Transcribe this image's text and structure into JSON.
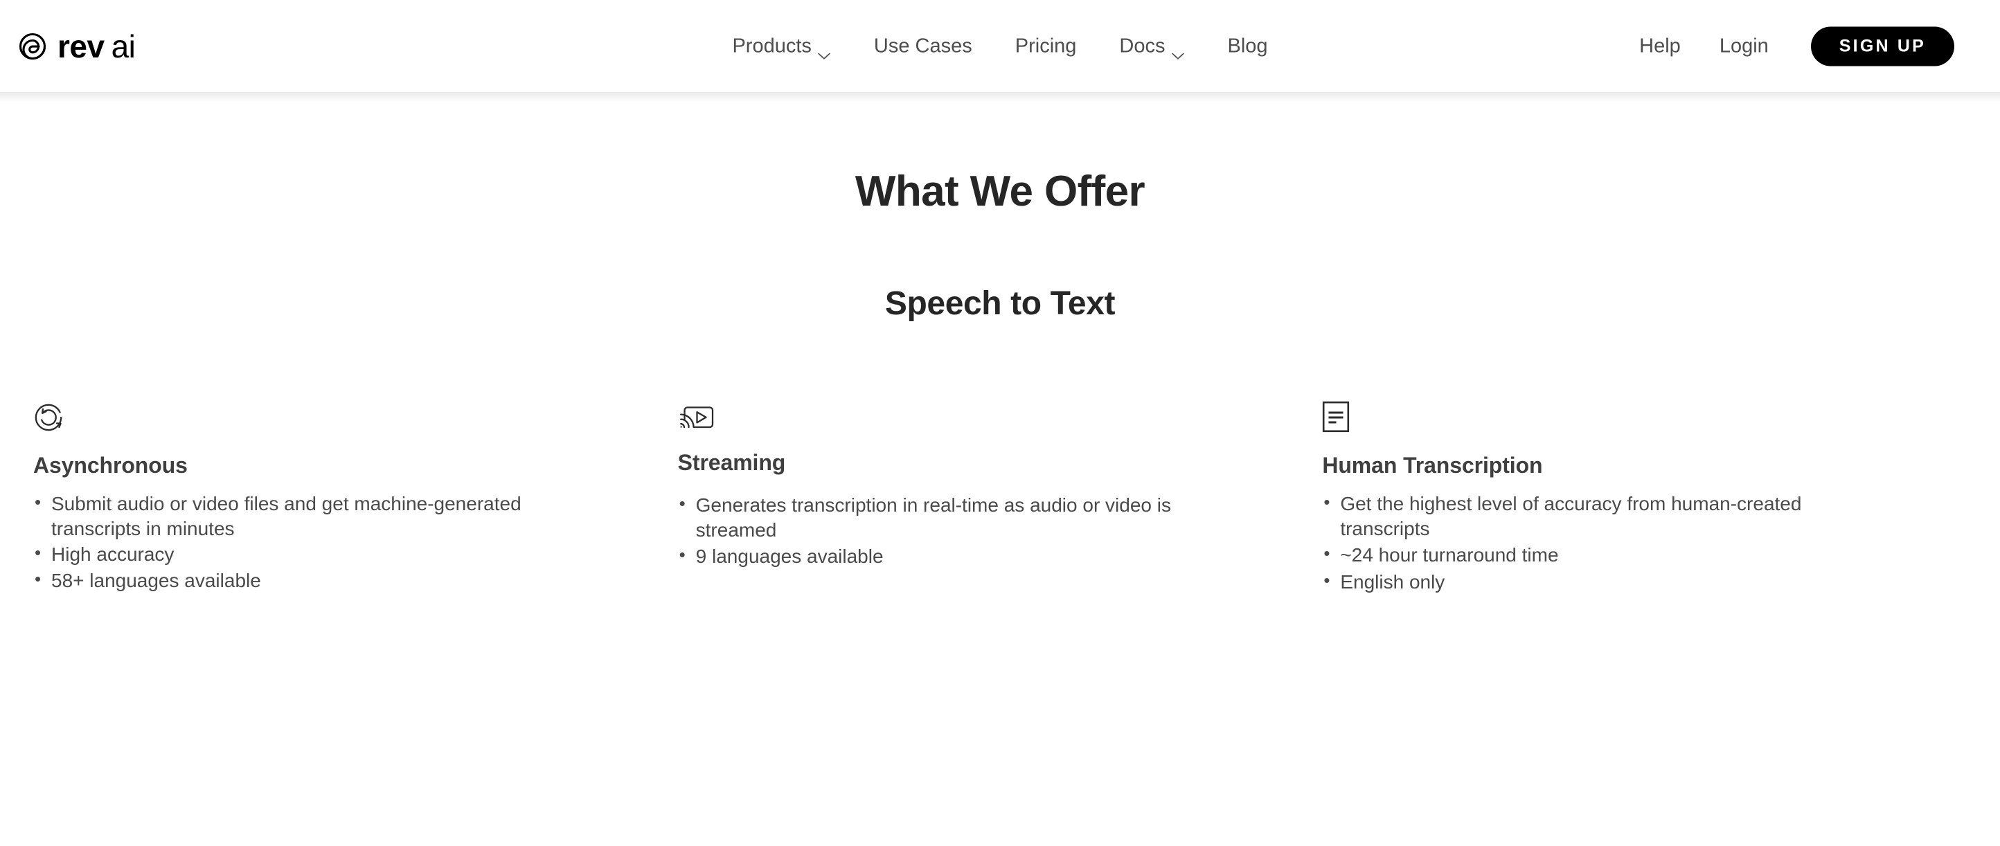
{
  "header": {
    "logo": {
      "mark_icon": "rev-spiral-logo-icon",
      "word_bold": "rev",
      "word_light": "ai"
    },
    "nav_items": [
      {
        "label": "Products",
        "has_dropdown": true,
        "icon": "chevron-down-icon"
      },
      {
        "label": "Use Cases",
        "has_dropdown": false,
        "icon": ""
      },
      {
        "label": "Pricing",
        "has_dropdown": false,
        "icon": ""
      },
      {
        "label": "Docs",
        "has_dropdown": true,
        "icon": "chevron-down-icon"
      },
      {
        "label": "Blog",
        "has_dropdown": false,
        "icon": ""
      }
    ],
    "utility_links": [
      {
        "label": "Help"
      },
      {
        "label": "Login"
      }
    ],
    "signup_label": "SIGN UP"
  },
  "main": {
    "section_title": "What We Offer",
    "subsection_title": "Speech to Text",
    "features": [
      {
        "icon": "async-circular-arrows-icon",
        "heading": "Asynchronous",
        "bullets": [
          "Submit audio or video files and get machine-generated transcripts in minutes",
          "High accuracy",
          "58+ languages available"
        ]
      },
      {
        "icon": "streaming-cast-play-icon",
        "heading": "Streaming",
        "bullets": [
          "Generates transcription in real-time as audio or video is streamed",
          "9 languages available"
        ]
      },
      {
        "icon": "document-lines-icon",
        "heading": "Human Transcription",
        "bullets": [
          "Get the highest level of accuracy from human-created transcripts",
          "~24 hour turnaround time",
          "English only"
        ]
      }
    ]
  },
  "colors": {
    "page_background": "#ffffff",
    "heading_text": "#262626",
    "body_text": "#4a4a4a",
    "nav_text": "#4d4d4d",
    "button_background": "#000000",
    "button_text": "#ffffff",
    "icon_stroke": "#2b2b2b"
  }
}
